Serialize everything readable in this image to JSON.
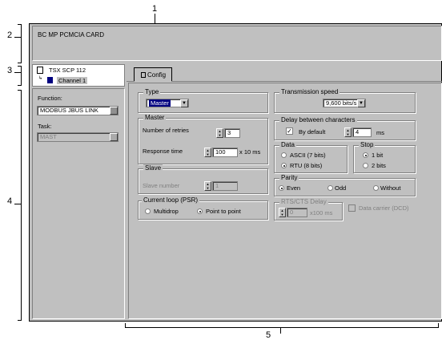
{
  "callouts": {
    "c1": "1",
    "c2": "2",
    "c3": "3",
    "c4": "4",
    "c5": "5"
  },
  "module": {
    "title": "BC MP PCMCIA CARD"
  },
  "tree": {
    "device": "TSX SCP 112",
    "channel": "Channel 1"
  },
  "left": {
    "function_label": "Function:",
    "function_value": "MODBUS JBUS LINK",
    "task_label": "Task:",
    "task_value": "MAST"
  },
  "tab": {
    "label": "Config"
  },
  "type": {
    "title": "Type",
    "value": "Master"
  },
  "master": {
    "title": "Master",
    "retries_label": "Number of retries",
    "retries_value": "3",
    "response_label": "Response time",
    "response_value": "100",
    "response_unit": "x 10 ms"
  },
  "slave": {
    "title": "Slave",
    "number_label": "Slave number",
    "number_value": "1"
  },
  "current_loop": {
    "title": "Current loop (PSR)",
    "multidrop": "Multidrop",
    "p2p": "Point to point",
    "selected": "p2p"
  },
  "speed": {
    "title": "Transmission speed",
    "value": "9,600 bits/s"
  },
  "delay": {
    "title": "Delay between characters",
    "by_default": "By default",
    "value": "4",
    "unit": "ms"
  },
  "data": {
    "title": "Data",
    "ascii": "ASCII (7 bits)",
    "rtu": "RTU (8 bits)",
    "selected": "rtu"
  },
  "stop": {
    "title": "Stop",
    "one": "1 bit",
    "two": "2 bits",
    "selected": "one"
  },
  "parity": {
    "title": "Parity",
    "even": "Even",
    "odd": "Odd",
    "without": "Without",
    "selected": "even"
  },
  "rts": {
    "title": "RTS/CTS Delay",
    "value": "0",
    "unit": "x100 ms"
  },
  "carrier": {
    "label": "Data carrier (DCD)"
  }
}
